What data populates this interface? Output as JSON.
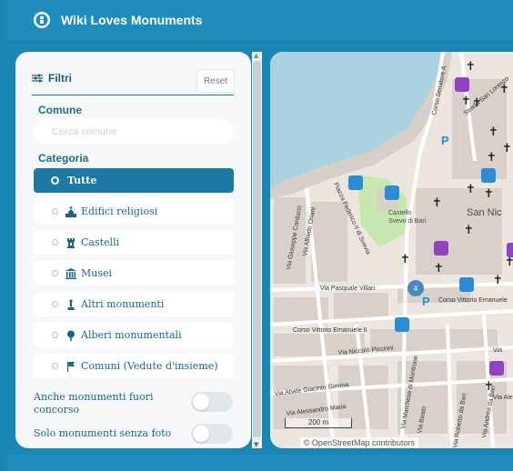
{
  "app": {
    "title": "Wiki Loves Monuments"
  },
  "filters": {
    "heading": "Filtri",
    "reset_label": "Reset",
    "comune_label": "Comune",
    "comune_placeholder": "Cerca comune",
    "categoria_label": "Categoria",
    "categories": [
      {
        "label": "Tutte",
        "icon": "radio-dot-icon",
        "selected": true
      },
      {
        "label": "Edifici religiosi",
        "icon": "church-icon",
        "selected": false
      },
      {
        "label": "Castelli",
        "icon": "castle-icon",
        "selected": false
      },
      {
        "label": "Musei",
        "icon": "museum-icon",
        "selected": false
      },
      {
        "label": "Altri monumenti",
        "icon": "monument-icon",
        "selected": false
      },
      {
        "label": "Alberi monumentali",
        "icon": "tree-icon",
        "selected": false
      },
      {
        "label": "Comuni (Vedute d'insieme)",
        "icon": "flag-icon",
        "selected": false
      }
    ],
    "toggles": [
      {
        "label": "Anche monumenti fuori concorso",
        "on": false
      },
      {
        "label": "Solo monumenti senza foto",
        "on": false
      }
    ]
  },
  "map": {
    "streets": [
      "Corso Senatore A.",
      "Strada San Lorenzo",
      "Piazza Federico II di Svevia",
      "Via Alfredo Oriani",
      "Via Giuseppe Carducci",
      "Via Pasquale Villari",
      "Corso Vittorio Emanuele II",
      "Corso Vittorio Emanuele",
      "Via Niccolò Piccinni",
      "Via Abate Giacinto Gimma",
      "Via Alessandro Maria",
      "Via Andrea da Bari",
      "Via Roberto da Bari",
      "Via Marchese di Montrone",
      "Via Beato",
      "Via Ale",
      "Via"
    ],
    "places": [
      "Castello Svevo di Bari",
      "San Nic"
    ],
    "cluster_count": "4",
    "scale_label": "200 m",
    "attribution": "© OpenStreetMap contributors",
    "colors": {
      "water": "#aad3df",
      "land": "#ece6df",
      "building": "#d9d0c9",
      "park": "#c8e6b0",
      "poi_blue": "#2a8bd6",
      "poi_purple": "#8e44c2",
      "cluster": "#4a88c4"
    }
  }
}
